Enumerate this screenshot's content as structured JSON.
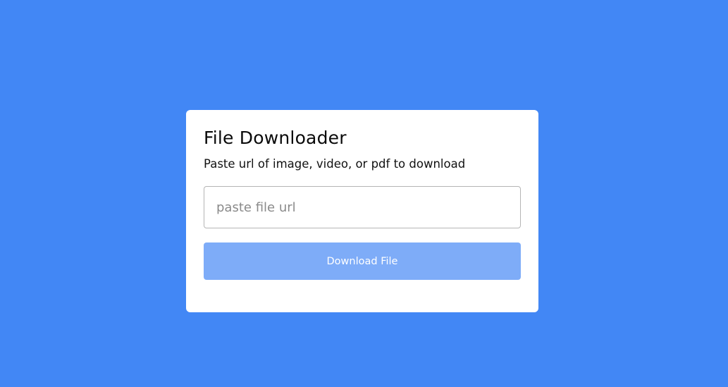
{
  "card": {
    "title": "File Downloader",
    "subtitle": "Paste url of image, video, or pdf to download",
    "url_input": {
      "value": "",
      "placeholder": "paste file url"
    },
    "download_button_label": "Download File"
  },
  "colors": {
    "background": "#4287f5",
    "card": "#ffffff",
    "button": "#7eacf8",
    "button_text": "#ffffff"
  }
}
